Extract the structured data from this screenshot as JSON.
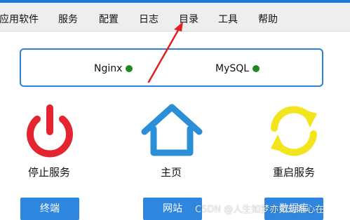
{
  "menu": {
    "items": [
      {
        "label": "应用软件"
      },
      {
        "label": "服务"
      },
      {
        "label": "配置"
      },
      {
        "label": "日志"
      },
      {
        "label": "目录"
      },
      {
        "label": "工具"
      },
      {
        "label": "帮助"
      }
    ]
  },
  "status": {
    "nginx": {
      "label": "Nginx",
      "state": "running"
    },
    "mysql": {
      "label": "MySQL",
      "state": "running"
    }
  },
  "tiles": {
    "stop": {
      "label": "停止服务",
      "icon": "power-icon"
    },
    "home": {
      "label": "主页",
      "icon": "home-icon"
    },
    "restart": {
      "label": "重启服务",
      "icon": "refresh-icon"
    }
  },
  "buttons": {
    "terminal": "终端",
    "website": "网站",
    "database": "数据库"
  },
  "watermark": "CSDN @人生如梦亦如幻唯心在",
  "colors": {
    "accent": "#2f86de",
    "status_ok": "#1e8a1e",
    "power": "#e4252f",
    "home": "#2b8fd8",
    "refresh": "#f2e51c"
  }
}
